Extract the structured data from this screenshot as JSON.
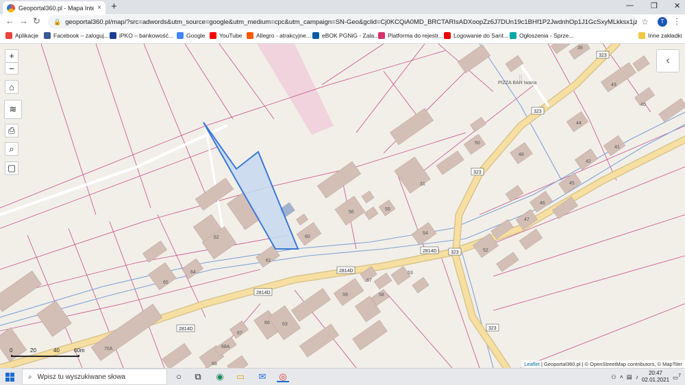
{
  "browser": {
    "tab_title": "Geoportal360.pl - Mapa Interakt...",
    "tab_close": "×",
    "new_tab": "+",
    "window_controls": [
      "—",
      "❐",
      "✕"
    ],
    "url": "geoportal360.pl/map/?src=adwords&utm_source=google&utm_medium=cpc&utm_campaign=SN-Geo&gclid=Cj0KCQiA0MD_BRCTARIsADXoopZz6J7DUn19c1BHf1P2JwdnhOp1J1GcSxyMLkksx1jzU2q9HyOmIQsaAgJ...",
    "profile_initial": "T"
  },
  "bookmarks": [
    {
      "label": "Aplikacje",
      "color": "#e8453c"
    },
    {
      "label": "Facebook – zaloguj...",
      "color": "#3b5998"
    },
    {
      "label": "iPKO – bankowość...",
      "color": "#1b3d8f"
    },
    {
      "label": "Google",
      "color": "#4285f4"
    },
    {
      "label": "YouTube",
      "color": "#ff0000"
    },
    {
      "label": "Allegro - atrakcyjne...",
      "color": "#ff5a00"
    },
    {
      "label": "eBOK PGNiG - Zala...",
      "color": "#0a5aa5"
    },
    {
      "label": "Platforma do rejestr...",
      "color": "#d6336c"
    },
    {
      "label": "Logowanie do Sant...",
      "color": "#ec0000"
    },
    {
      "label": "Ogłoszenia - Sprze...",
      "color": "#00a8a8"
    },
    {
      "label": "Inne zakładki",
      "color": "#f2c744"
    }
  ],
  "map": {
    "controls": {
      "zoom_in": "+",
      "zoom_out": "−",
      "home": "⌂",
      "layers": "≋",
      "print": "⎙",
      "search": "⌕",
      "legend": "▢"
    },
    "collapse_icon": "‹",
    "poi_label": "PIZZA BAR Iwana",
    "house_numbers": [
      "39",
      "43",
      "40",
      "44",
      "41",
      "42",
      "45",
      "46",
      "47",
      "48",
      "50",
      "31",
      "56",
      "55",
      "60",
      "54",
      "52",
      "53",
      "57",
      "58",
      "59",
      "61",
      "62",
      "64",
      "65",
      "66",
      "63",
      "67",
      "68A",
      "68",
      "70A"
    ],
    "road_labels": [
      "323",
      "323",
      "323",
      "323",
      "2814D",
      "2814D",
      "2814D",
      "2814D"
    ],
    "scale": {
      "labels": [
        "0",
        "20",
        "40",
        "60m"
      ]
    },
    "attribution": {
      "leaflet": "Leaflet",
      "rest": "| Geoportal360.pl | © OpenStreetMap contributors, © MapTiler"
    }
  },
  "taskbar": {
    "search_placeholder": "Wpisz tu wyszukiwane słowa",
    "time": "20:47",
    "date": "02.01.2021",
    "notification_count": "7"
  }
}
